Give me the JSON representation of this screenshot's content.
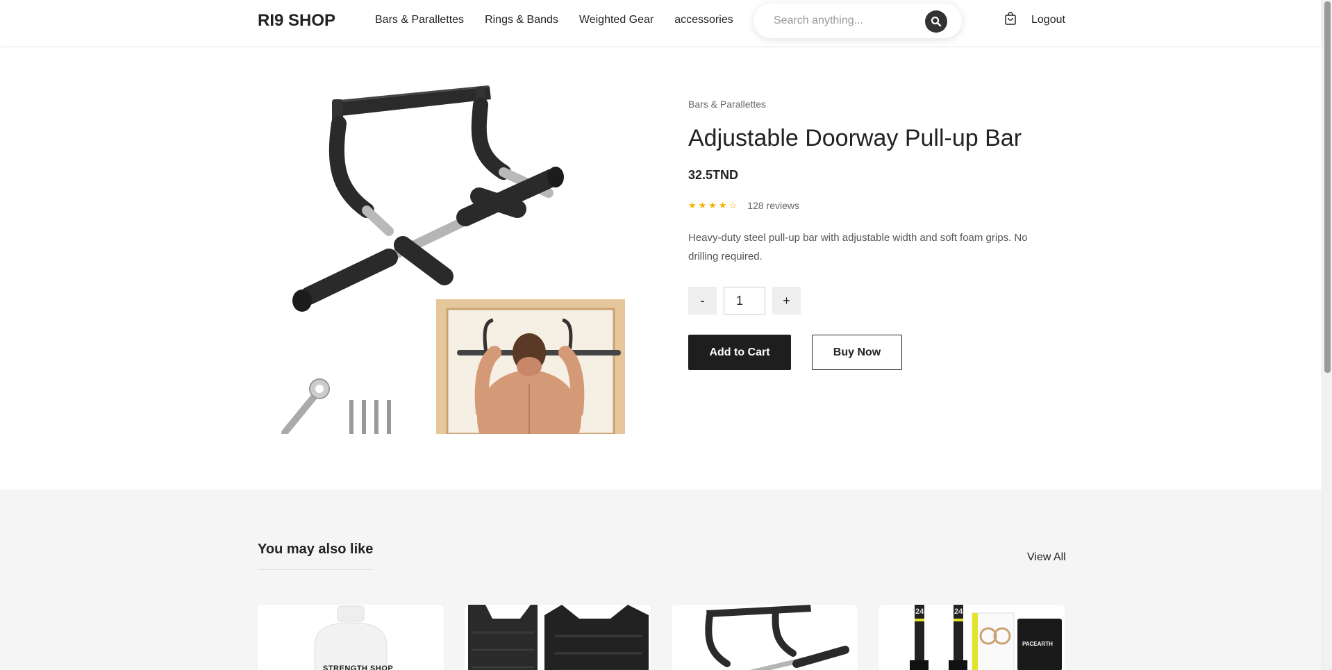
{
  "header": {
    "logo": "RI9 SHOP",
    "nav": [
      "Bars & Parallettes",
      "Rings & Bands",
      "Weighted Gear",
      "accessories"
    ],
    "search_placeholder": "Search anything...",
    "logout": "Logout"
  },
  "product": {
    "category": "Bars & Parallettes",
    "title": "Adjustable Doorway Pull-up Bar",
    "price": "32.5TND",
    "stars": "★★★★☆",
    "rating": 4,
    "reviews": "128 reviews",
    "description": "Heavy-duty steel pull-up bar with adjustable width and soft foam grips. No drilling required.",
    "qty_minus": "-",
    "qty_value": "1",
    "qty_plus": "+",
    "add_to_cart": "Add to Cart",
    "buy_now": "Buy Now"
  },
  "related": {
    "title": "You may also like",
    "view_all": "View All",
    "cards": [
      {
        "bottle_label": "STRENGTH SHOP"
      },
      {},
      {},
      {
        "tag1": "24",
        "tag2": "24",
        "brand": "PACEARTH"
      }
    ]
  },
  "colors": {
    "accent_dark": "#1e1e1e",
    "star": "#f5b301",
    "section_bg": "#f5f5f5"
  }
}
